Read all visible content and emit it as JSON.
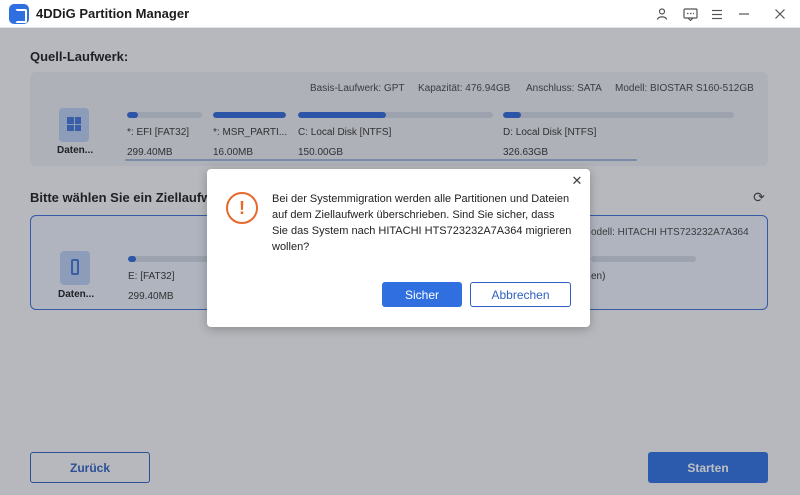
{
  "app": {
    "title": "4DDiG Partition Manager"
  },
  "titlebar": {
    "icons": [
      "user-icon",
      "feedback-icon",
      "menu-icon",
      "minimize-icon",
      "close-icon"
    ]
  },
  "source": {
    "section_label": "Quell-Laufwerk:",
    "info": {
      "basis": "Basis-Laufwerk: GPT",
      "capacity": "Kapazität: 476.94GB",
      "connection": "Anschluss: SATA",
      "model": "Modell: BIOSTAR S160-512GB"
    },
    "disk_name": "Daten...",
    "partitions": [
      {
        "label": "*: EFI [FAT32]",
        "size": "299.40MB",
        "fill": 0.15
      },
      {
        "label": "*: MSR_PARTI...",
        "size": "16.00MB",
        "fill": 1.0
      },
      {
        "label": "C: Local Disk [NTFS]",
        "size": "150.00GB",
        "fill": 0.45
      },
      {
        "label": "D: Local Disk [NTFS]",
        "size": "326.63GB",
        "fill": 0.04
      }
    ]
  },
  "target": {
    "section_label": "Bitte wählen Sie ein Ziellaufwerk",
    "model_partial": "odell: HITACHI HTS723232A7A364",
    "disk_name": "Daten...",
    "partitions": [
      {
        "label": "E:  [FAT32]",
        "size": "299.40MB",
        "fill": 0.08
      }
    ],
    "partial_label": "en)"
  },
  "buttons": {
    "back": "Zurück",
    "start": "Starten"
  },
  "dialog": {
    "message": "Bei der Systemmigration werden alle Partitionen und Dateien auf dem Ziellaufwerk überschrieben. Sind Sie sicher, dass Sie das System nach HITACHI HTS723232A7A364 migrieren wollen?",
    "ok": "Sicher",
    "cancel": "Abbrechen"
  },
  "colors": {
    "accent": "#2f6fe0",
    "warning": "#e8682b"
  }
}
